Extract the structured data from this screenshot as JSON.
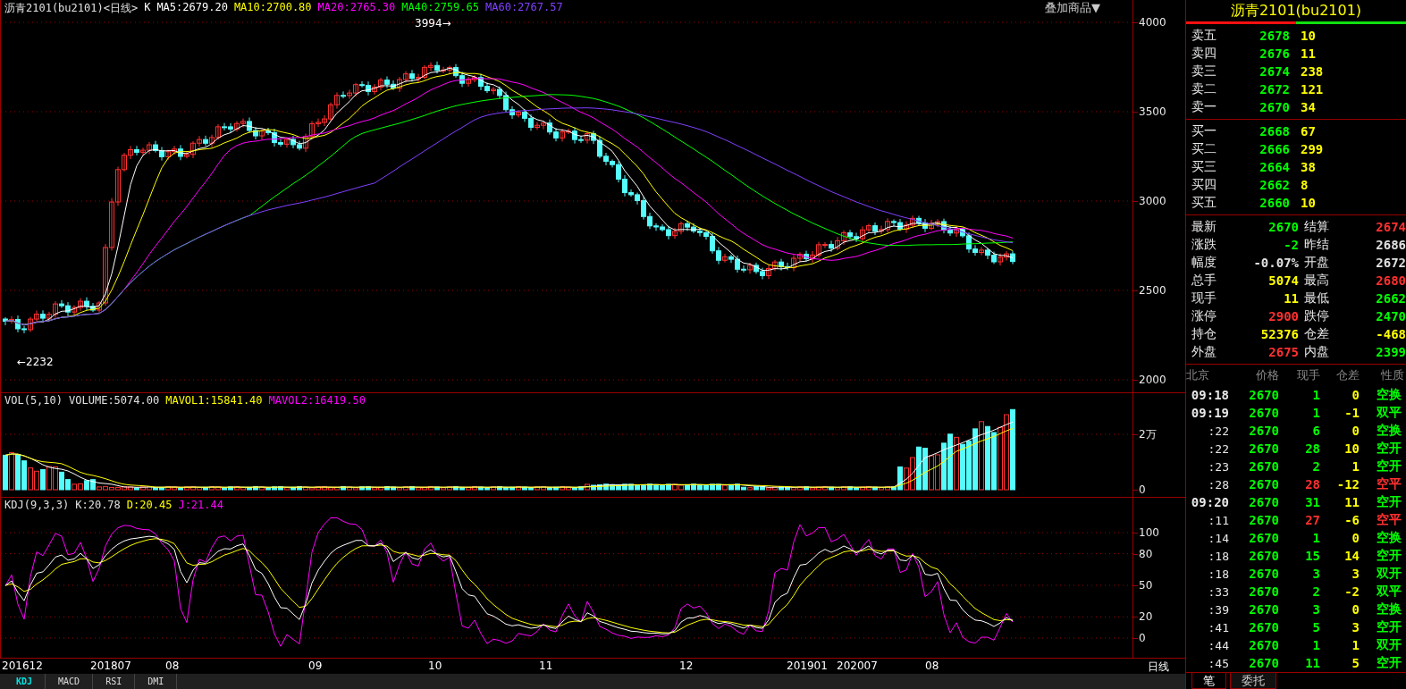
{
  "price_pane": {
    "legend": [
      {
        "text": "沥青2101(bu2101)<日线>",
        "color": "#e0e0e0"
      },
      {
        "text": "K",
        "color": "#ffffff"
      },
      {
        "text": "MA5:2679.20",
        "color": "#ffffff"
      },
      {
        "text": "MA10:2700.80",
        "color": "#ffff00"
      },
      {
        "text": "MA20:2765.30",
        "color": "#ff00ff"
      },
      {
        "text": "MA40:2759.65",
        "color": "#00ff00"
      },
      {
        "text": "MA60:2767.57",
        "color": "#8040ff"
      }
    ],
    "overlay_menu": "叠加商品▼",
    "high_label": "3994→",
    "low_label": "←2232",
    "y_ticks": [
      "4000",
      "3500",
      "3000",
      "2500",
      "2000"
    ]
  },
  "volume_pane": {
    "legend": [
      {
        "text": "VOL(5,10)",
        "color": "#e0e0e0"
      },
      {
        "text": "VOLUME:5074.00",
        "color": "#e0e0e0"
      },
      {
        "text": "MAVOL1:15841.40",
        "color": "#ffff00"
      },
      {
        "text": "MAVOL2:16419.50",
        "color": "#ff00ff"
      }
    ],
    "y_ticks": [
      "2万",
      "0"
    ]
  },
  "kdj_pane": {
    "legend": [
      {
        "text": "KDJ(9,3,3)",
        "color": "#e0e0e0"
      },
      {
        "text": "K:20.78",
        "color": "#e0e0e0"
      },
      {
        "text": "D:20.45",
        "color": "#ffff00"
      },
      {
        "text": "J:21.44",
        "color": "#ff00ff"
      }
    ],
    "y_ticks": [
      "100",
      "80",
      "50",
      "20",
      "0"
    ]
  },
  "date_axis": [
    "201612",
    "201807",
    "08",
    "09",
    "10",
    "11",
    "12",
    "201901",
    "202007",
    "08"
  ],
  "period": "日线",
  "indicator_tabs": [
    {
      "label": "KDJ",
      "selected": true
    },
    {
      "label": "MACD",
      "selected": false
    },
    {
      "label": "RSI",
      "selected": false
    },
    {
      "label": "DMI",
      "selected": false
    }
  ],
  "quote": {
    "title": "沥青2101(bu2101)",
    "asks": [
      {
        "label": "卖五",
        "price": "2678",
        "volume": "10"
      },
      {
        "label": "卖四",
        "price": "2676",
        "volume": "11"
      },
      {
        "label": "卖三",
        "price": "2674",
        "volume": "238"
      },
      {
        "label": "卖二",
        "price": "2672",
        "volume": "121"
      },
      {
        "label": "卖一",
        "price": "2670",
        "volume": "34"
      }
    ],
    "bids": [
      {
        "label": "买一",
        "price": "2668",
        "volume": "67"
      },
      {
        "label": "买二",
        "price": "2666",
        "volume": "299"
      },
      {
        "label": "买三",
        "price": "2664",
        "volume": "38"
      },
      {
        "label": "买四",
        "price": "2662",
        "volume": "8"
      },
      {
        "label": "买五",
        "price": "2660",
        "volume": "10"
      }
    ],
    "stats": [
      {
        "left": {
          "label": "最新",
          "value": "2670",
          "color": "#00ff00"
        },
        "right": {
          "label": "结算",
          "value": "2674",
          "color": "#ff3030"
        }
      },
      {
        "left": {
          "label": "涨跌",
          "value": "-2",
          "color": "#00ff00"
        },
        "right": {
          "label": "昨结",
          "value": "2686",
          "color": "#e0e0e0"
        }
      },
      {
        "left": {
          "label": "幅度",
          "value": "-0.07%",
          "color": "#e0e0e0"
        },
        "right": {
          "label": "开盘",
          "value": "2672",
          "color": "#e0e0e0"
        }
      },
      {
        "left": {
          "label": "总手",
          "value": "5074",
          "color": "#ffff00"
        },
        "right": {
          "label": "最高",
          "value": "2680",
          "color": "#ff3030"
        }
      },
      {
        "left": {
          "label": "现手",
          "value": "11",
          "color": "#ffff00"
        },
        "right": {
          "label": "最低",
          "value": "2662",
          "color": "#00ff00"
        }
      },
      {
        "left": {
          "label": "涨停",
          "value": "2900",
          "color": "#ff3030"
        },
        "right": {
          "label": "跌停",
          "value": "2470",
          "color": "#00ff00"
        }
      },
      {
        "left": {
          "label": "持仓",
          "value": "52376",
          "color": "#ffff00"
        },
        "right": {
          "label": "仓差",
          "value": "-468",
          "color": "#ffff00"
        }
      },
      {
        "left": {
          "label": "外盘",
          "value": "2675",
          "color": "#ff3030"
        },
        "right": {
          "label": "内盘",
          "value": "2399",
          "color": "#00ff00"
        }
      }
    ],
    "tick_columns": [
      "北京",
      "价格",
      "现手",
      "仓差",
      "性质"
    ],
    "ticks": [
      {
        "kind": "minute",
        "time": "09:18",
        "price": "2670",
        "volume": {
          "text": "1",
          "color": "#00ff00"
        },
        "change": "0",
        "nature": {
          "text": "空换",
          "color": "#00ff00"
        }
      },
      {
        "kind": "minute",
        "time": "09:19",
        "price": "2670",
        "volume": {
          "text": "1",
          "color": "#00ff00"
        },
        "change": "-1",
        "nature": {
          "text": "双平",
          "color": "#00ff00"
        }
      },
      {
        "kind": "second",
        "time": ":22",
        "price": "2670",
        "volume": {
          "text": "6",
          "color": "#00ff00"
        },
        "change": "0",
        "nature": {
          "text": "空换",
          "color": "#00ff00"
        }
      },
      {
        "kind": "second",
        "time": ":22",
        "price": "2670",
        "volume": {
          "text": "28",
          "color": "#00ff00"
        },
        "change": "10",
        "nature": {
          "text": "空开",
          "color": "#00ff00"
        }
      },
      {
        "kind": "second",
        "time": ":23",
        "price": "2670",
        "volume": {
          "text": "2",
          "color": "#00ff00"
        },
        "change": "1",
        "nature": {
          "text": "空开",
          "color": "#00ff00"
        }
      },
      {
        "kind": "second",
        "time": ":28",
        "price": "2670",
        "volume": {
          "text": "28",
          "color": "#ff3030"
        },
        "change": "-12",
        "nature": {
          "text": "空平",
          "color": "#ff3030"
        }
      },
      {
        "kind": "minute",
        "time": "09:20",
        "price": "2670",
        "volume": {
          "text": "31",
          "color": "#00ff00"
        },
        "change": "11",
        "nature": {
          "text": "空开",
          "color": "#00ff00"
        }
      },
      {
        "kind": "second",
        "time": ":11",
        "price": "2670",
        "volume": {
          "text": "27",
          "color": "#ff3030"
        },
        "change": "-6",
        "nature": {
          "text": "空平",
          "color": "#ff3030"
        }
      },
      {
        "kind": "second",
        "time": ":14",
        "price": "2670",
        "volume": {
          "text": "1",
          "color": "#00ff00"
        },
        "change": "0",
        "nature": {
          "text": "空换",
          "color": "#00ff00"
        }
      },
      {
        "kind": "second",
        "time": ":18",
        "price": "2670",
        "volume": {
          "text": "15",
          "color": "#00ff00"
        },
        "change": "14",
        "nature": {
          "text": "空开",
          "color": "#00ff00"
        }
      },
      {
        "kind": "second",
        "time": ":18",
        "price": "2670",
        "volume": {
          "text": "3",
          "color": "#00ff00"
        },
        "change": "3",
        "nature": {
          "text": "双开",
          "color": "#00ff00"
        }
      },
      {
        "kind": "second",
        "time": ":33",
        "price": "2670",
        "volume": {
          "text": "2",
          "color": "#00ff00"
        },
        "change": "-2",
        "nature": {
          "text": "双平",
          "color": "#00ff00"
        }
      },
      {
        "kind": "second",
        "time": ":39",
        "price": "2670",
        "volume": {
          "text": "3",
          "color": "#00ff00"
        },
        "change": "0",
        "nature": {
          "text": "空换",
          "color": "#00ff00"
        }
      },
      {
        "kind": "second",
        "time": ":41",
        "price": "2670",
        "volume": {
          "text": "5",
          "color": "#00ff00"
        },
        "change": "3",
        "nature": {
          "text": "空开",
          "color": "#00ff00"
        }
      },
      {
        "kind": "second",
        "time": ":44",
        "price": "2670",
        "volume": {
          "text": "1",
          "color": "#00ff00"
        },
        "change": "1",
        "nature": {
          "text": "双开",
          "color": "#00ff00"
        }
      },
      {
        "kind": "second",
        "time": ":45",
        "price": "2670",
        "volume": {
          "text": "11",
          "color": "#00ff00"
        },
        "change": "5",
        "nature": {
          "text": "空开",
          "color": "#00ff00"
        }
      }
    ],
    "bottom_tabs": [
      {
        "label": "笔",
        "selected": true
      },
      {
        "label": "委托",
        "selected": false
      }
    ]
  }
}
